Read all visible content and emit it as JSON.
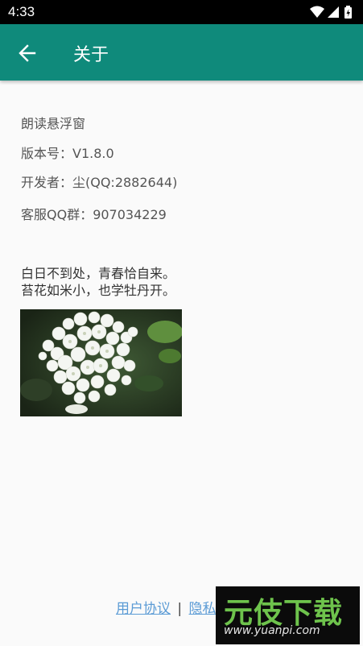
{
  "status_bar": {
    "time": "4:33",
    "icons": [
      "wifi-icon",
      "signal-icon",
      "battery-icon"
    ]
  },
  "app_bar": {
    "title": "关于",
    "back_icon": "arrow-left-icon",
    "background_color": "#0f8a7b"
  },
  "info": {
    "app_name": "朗读悬浮窗",
    "version": "版本号：V1.8.0",
    "developer": "开发者：尘(QQ:2882644)",
    "support_group": "客服QQ群：907034229"
  },
  "poem": {
    "line1": "白日不到处，青春恰自来。",
    "line2": "苔花如米小，也学牡丹开。"
  },
  "footer": {
    "user_agreement": "用户协议",
    "separator": "|",
    "privacy_policy_visible": "隐私政"
  },
  "watermark": {
    "main": "元伎下载",
    "url": "www.yuanpi.com"
  }
}
